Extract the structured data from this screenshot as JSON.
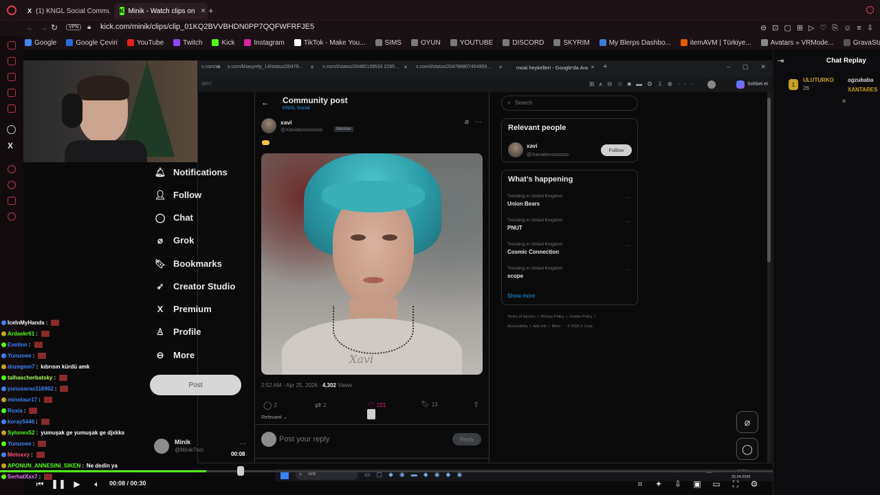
{
  "browser": {
    "tabs": [
      {
        "label": "(1) KNGL Social Communi",
        "icon": "x-logo-icon"
      },
      {
        "label": "Minik - Watch clips on",
        "icon": "kick-logo-icon"
      }
    ],
    "new_tab": "+",
    "url_badge": "VPN",
    "url": "kick.com/minik/clips/clip_01KQ2BVVBHDN0PP7QQFWFRFJE5",
    "bookmarks": [
      "Google",
      "Google Çeviri",
      "YouTube",
      "Twitch",
      "Kick",
      "Instagram",
      "TikTok - Make You...",
      "SIMS",
      "OYUN",
      "YOUTUBE",
      "DISCORD",
      "SKYRIM",
      "My Blerps Dashbo...",
      "itemAVM | Türkiye...",
      "Avatars » VRMode...",
      "GravaStar Web-ba..."
    ],
    "bookmark_colors": [
      "#4285f4",
      "#2b6cde",
      "#e62117",
      "#9146ff",
      "#53fc18",
      "#d6249f",
      "#ffffff",
      "#7a7a7a",
      "#7a7a7a",
      "#7a7a7a",
      "#7a7a7a",
      "#7a7a7a",
      "#3a7bd5",
      "#e65c00",
      "#888888",
      "#555555"
    ]
  },
  "inner_browser": {
    "tabs": [
      "x.com/i/status/20479",
      "x.com/khasymly_14/status/20479...",
      "x.com/i/status/20480139533 2295...",
      "x.com/i/status/204786807404959...",
      "moai heykelleri - Google'da Ara"
    ],
    "sohbet": "Sohbet et",
    "url_fragment": "8857"
  },
  "x_nav": {
    "items": [
      {
        "label": "Notifications",
        "icon": "bell-icon"
      },
      {
        "label": "Follow",
        "icon": "follow-user-icon"
      },
      {
        "label": "Chat",
        "icon": "chat-bubble-icon"
      },
      {
        "label": "Grok",
        "icon": "grok-icon"
      },
      {
        "label": "Bookmarks",
        "icon": "bookmark-icon"
      },
      {
        "label": "Creator Studio",
        "icon": "rocket-icon"
      },
      {
        "label": "Premium",
        "icon": "x-premium-icon"
      },
      {
        "label": "Profile",
        "icon": "person-icon"
      },
      {
        "label": "More",
        "icon": "more-circle-icon"
      }
    ],
    "post_button": "Post",
    "account_name": "Minik",
    "account_handle": "@MinikTnci"
  },
  "post": {
    "header_title": "Community post",
    "header_subtitle": "KNGL Social",
    "author_name": "xavi",
    "author_handle": "@Xavialonsooooo",
    "author_badge": "Member",
    "watermark": "Xavi",
    "time": "2:52 AM · Apr 25, 2026 · ",
    "views_count": "4,302",
    "views_label": " Views",
    "replies": "2",
    "reposts": "2",
    "likes": "221",
    "bookmarks": "13",
    "sort_label": "Relevant ⌄",
    "reply_placeholder": "Post your reply",
    "reply_button": "Reply"
  },
  "right_column": {
    "search_placeholder": "Search",
    "relevant_title": "Relevant people",
    "person_name": "xavi",
    "person_handle": "@Xavialonsooooo",
    "follow_button": "Follow",
    "happening_title": "What’s happening",
    "trends": [
      {
        "context": "Trending in United Kingdom",
        "name": "Union Bears"
      },
      {
        "context": "Trending in United Kingdom",
        "name": "PNUT"
      },
      {
        "context": "Trending in United Kingdom",
        "name": "Cosmic Connection"
      },
      {
        "context": "Trending in United Kingdom",
        "name": "scope"
      }
    ],
    "show_more": "Show more",
    "footer_line1": "Terms of Service  |  Privacy Policy  |  Cookie Policy  |",
    "footer_line2": "Accessibility  |  Ads info  |  More ···  © 2026 X Corp."
  },
  "chat": {
    "lines": [
      {
        "user": "IceInMyHands",
        "color": "#ffffff",
        "text": ""
      },
      {
        "user": "Ardaekr61",
        "color": "#53fc18",
        "text": ""
      },
      {
        "user": "Exetinn",
        "color": "#3b82f6",
        "text": ""
      },
      {
        "user": "Yunuswe",
        "color": "#3b82f6",
        "text": ""
      },
      {
        "user": "dnzegmn7",
        "color": "#3b82f6",
        "text": "kıbrısın kürdü amk"
      },
      {
        "user": "talhascherbatsky",
        "color": "#a8ff60",
        "text": ""
      },
      {
        "user": "yunusaras316962",
        "color": "#3b82f6",
        "text": ""
      },
      {
        "user": "minotaur17",
        "color": "#3b82f6",
        "text": ""
      },
      {
        "user": "Roxia",
        "color": "#3b82f6",
        "text": ""
      },
      {
        "user": "koray5446",
        "color": "#3b82f6",
        "text": ""
      },
      {
        "user": "Sylonex52",
        "color": "#53fc18",
        "text": "yumuşak ge yumuşak ge djxkks"
      },
      {
        "user": "Yunuswe",
        "color": "#3b82f6",
        "text": ""
      },
      {
        "user": "Metoxxy",
        "color": "#ff4d6d",
        "text": ""
      },
      {
        "user": "APONUN_ANNESINI_SIKEN",
        "color": "#53fc18",
        "text": "Ne dedin ya"
      },
      {
        "user": "SerhatXxx7",
        "color": "#e37bff",
        "text": ""
      }
    ]
  },
  "replay": {
    "title": "Chat Replay",
    "first_user": "ULUTURKO",
    "first_count": "26",
    "second_user": "ogzubaba",
    "third_user": "XANTARES"
  },
  "player": {
    "current": "00:08",
    "separator": " / ",
    "total": "00:30",
    "progress": 0.267,
    "clip_badge_time": "00:08"
  },
  "taskbar": {
    "search": "Ara",
    "lang": "TUR",
    "time": "14:04",
    "date": "25.04.2026"
  },
  "colors": {
    "kick_green": "#53fc18",
    "like_pink": "#f91880",
    "x_blue": "#1d9bf0"
  }
}
